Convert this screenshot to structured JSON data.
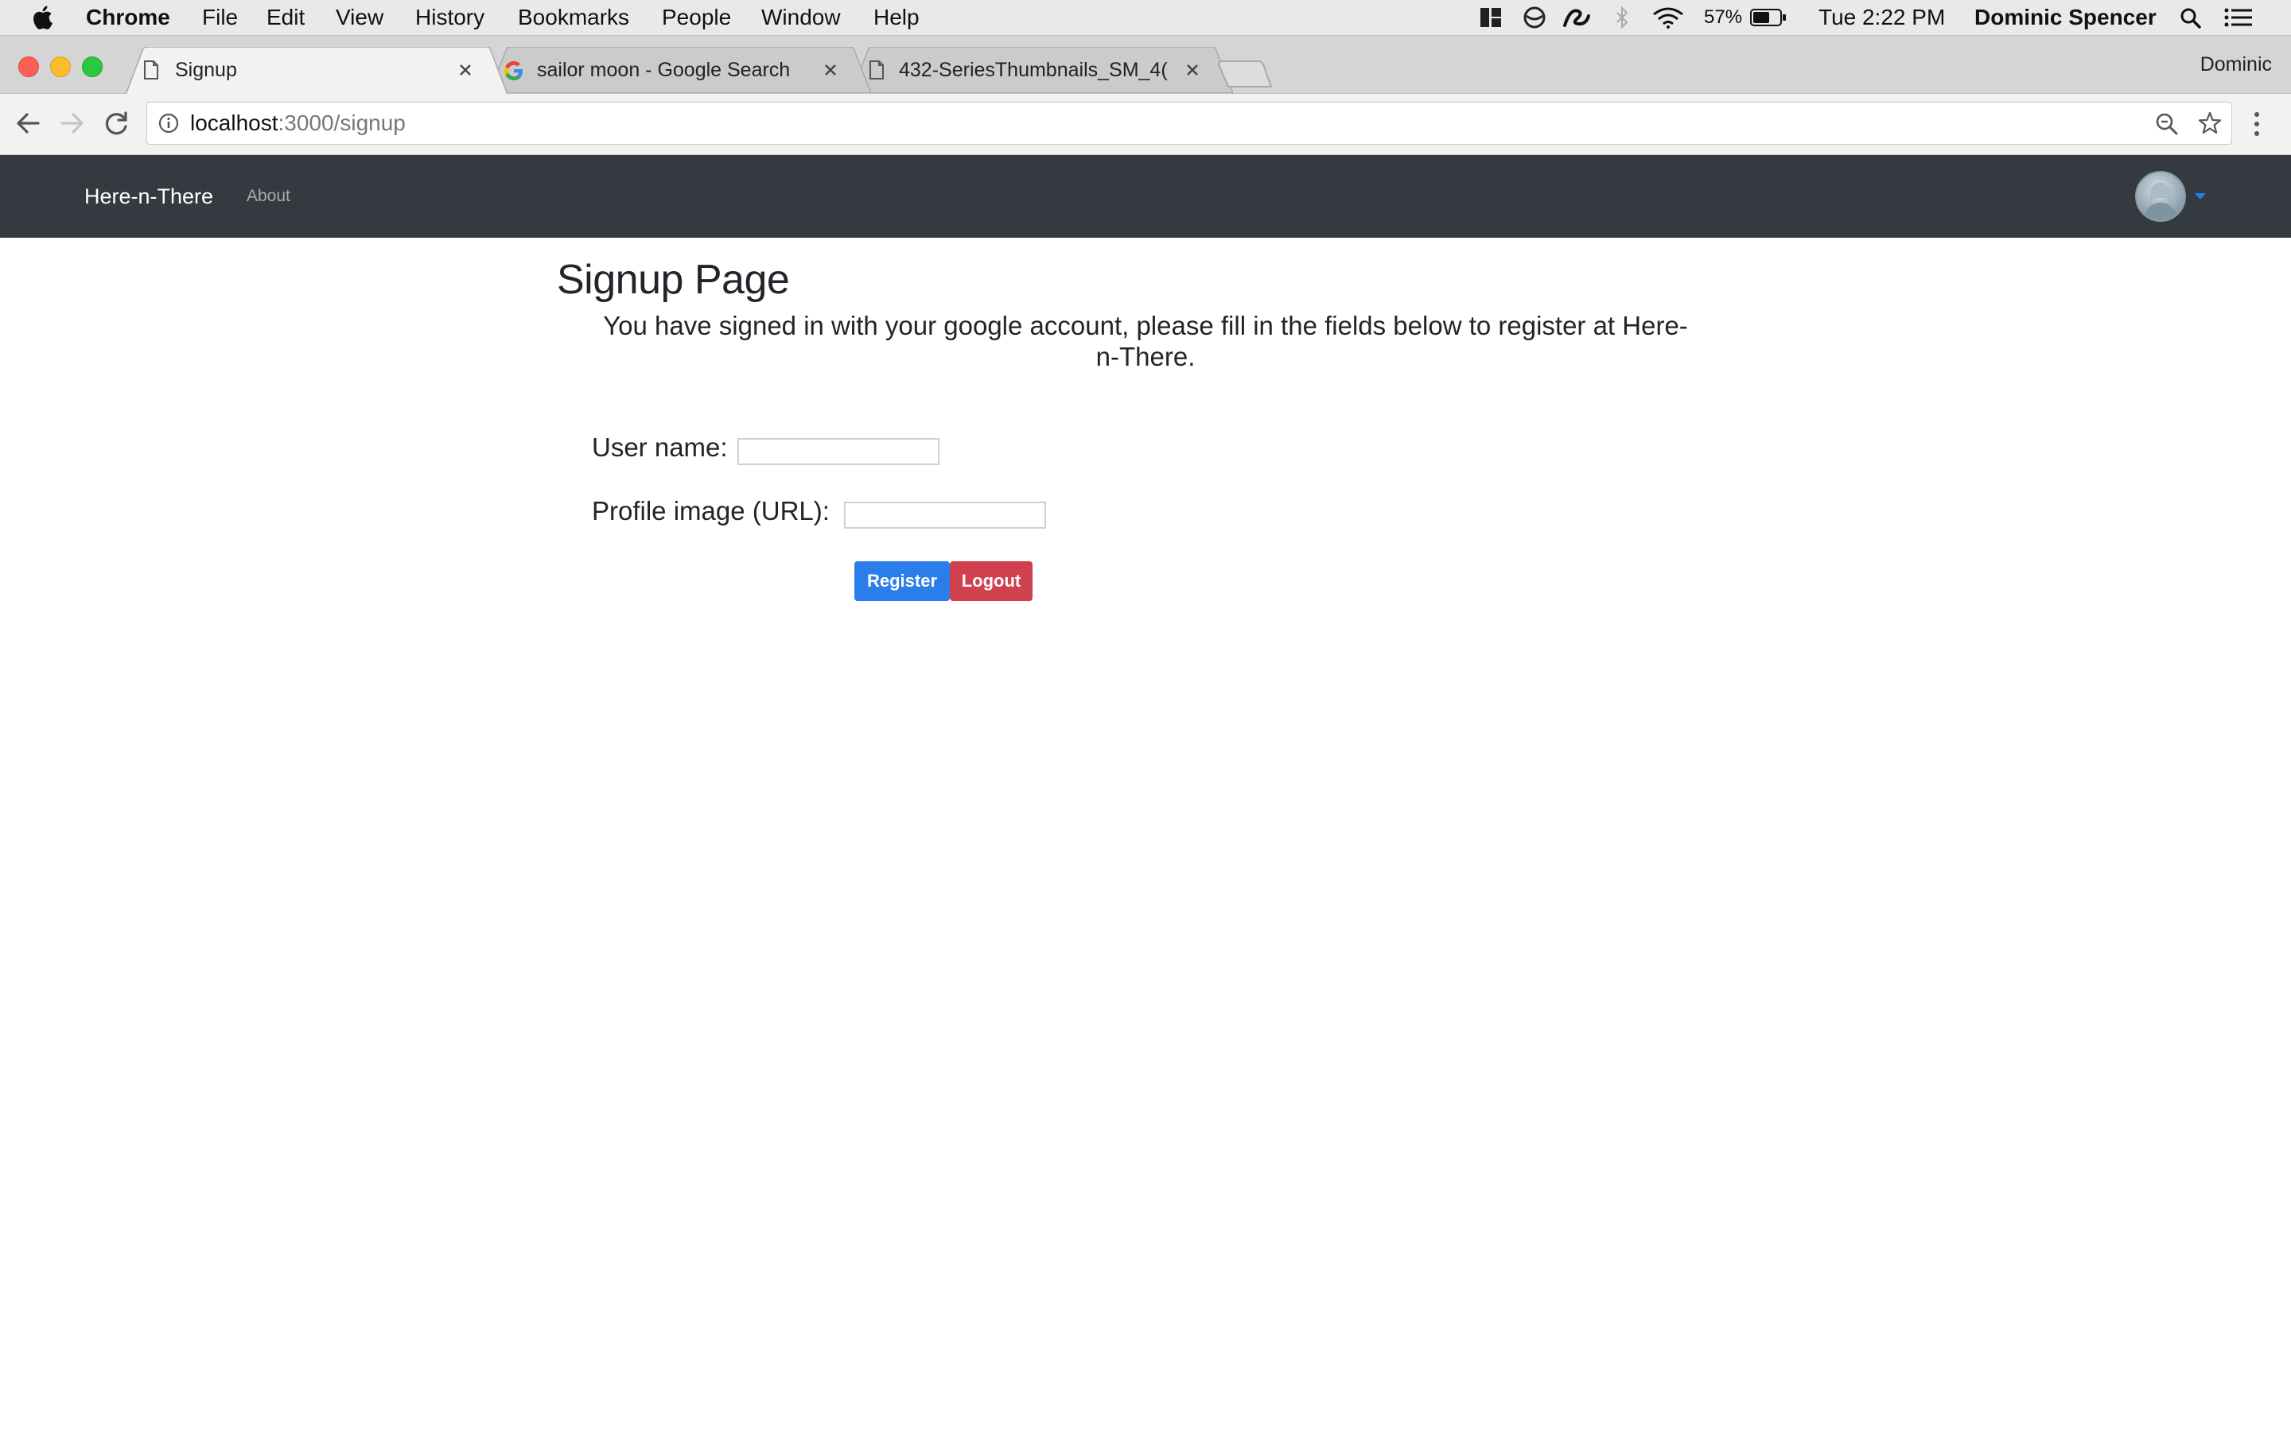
{
  "menubar": {
    "app_name": "Chrome",
    "items": [
      "File",
      "Edit",
      "View",
      "History",
      "Bookmarks",
      "People",
      "Window",
      "Help"
    ],
    "battery": "57%",
    "clock": "Tue 2:22 PM",
    "user": "Dominic Spencer",
    "status_icons": [
      "grid-icon",
      "focus-icon",
      "sync-icon",
      "bluetooth-icon",
      "wifi-icon",
      "battery-icon"
    ]
  },
  "browser": {
    "profile_name": "Dominic",
    "tabs": [
      {
        "title": "Signup",
        "icon": "page-icon",
        "active": true
      },
      {
        "title": "sailor moon - Google Search",
        "icon": "google-icon",
        "active": false
      },
      {
        "title": "432-SeriesThumbnails_SM_4(",
        "icon": "page-icon",
        "active": false
      }
    ],
    "url": {
      "host": "localhost",
      "path": ":3000/signup"
    }
  },
  "navbar": {
    "brand": "Here-n-There",
    "links": [
      "About"
    ]
  },
  "page": {
    "title": "Signup Page",
    "intro_line1": "You have signed in with your google account, please fill in the fields below to register at Here-",
    "intro_line2": "n-There.",
    "fields": [
      {
        "label": "User name:",
        "value": ""
      },
      {
        "label": "Profile image (URL):",
        "value": ""
      }
    ],
    "buttons": {
      "register": "Register",
      "logout": "Logout"
    }
  },
  "colors": {
    "navbar_bg": "#343a40",
    "register_button": "#2b7de9",
    "logout_button": "#d0404e",
    "avatar_caret": "#2b7de9"
  }
}
